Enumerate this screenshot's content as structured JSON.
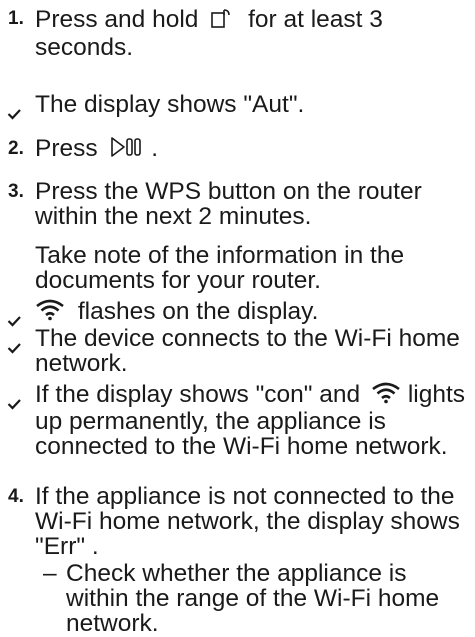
{
  "steps": [
    {
      "num": "1.",
      "before": "Press and hold",
      "after": "for at least 3 seconds.",
      "icon": "timer-start-icon"
    },
    {
      "num": "2.",
      "before": "Press",
      "after": ".",
      "icon": "start-pause-icon"
    },
    {
      "num": "3.",
      "text": "Press the WPS button on the router within the next 2 minutes."
    },
    {
      "num": "4.",
      "text": "If the appliance is not connected to the Wi-Fi home network, the display shows \"Err\" ."
    }
  ],
  "notes": {
    "router_docs": "Take note of the information in the documents for your router."
  },
  "results": {
    "display_aut": "The display shows \"Aut\".",
    "wifi_flashes": "flashes on the display.",
    "device_connects": "The device connects to the Wi-Fi home network.",
    "connected_before": "If the display shows \"con\"  and",
    "connected_after": "lights up permanently, the appliance is connected to the Wi-Fi home network."
  },
  "sub_steps": [
    {
      "text": "Check whether the appliance is within the range of the Wi-Fi home network."
    }
  ],
  "icons": {
    "check": "check-icon",
    "wifi": "wifi-icon"
  },
  "colors": {
    "text": "#1a1a1a"
  }
}
